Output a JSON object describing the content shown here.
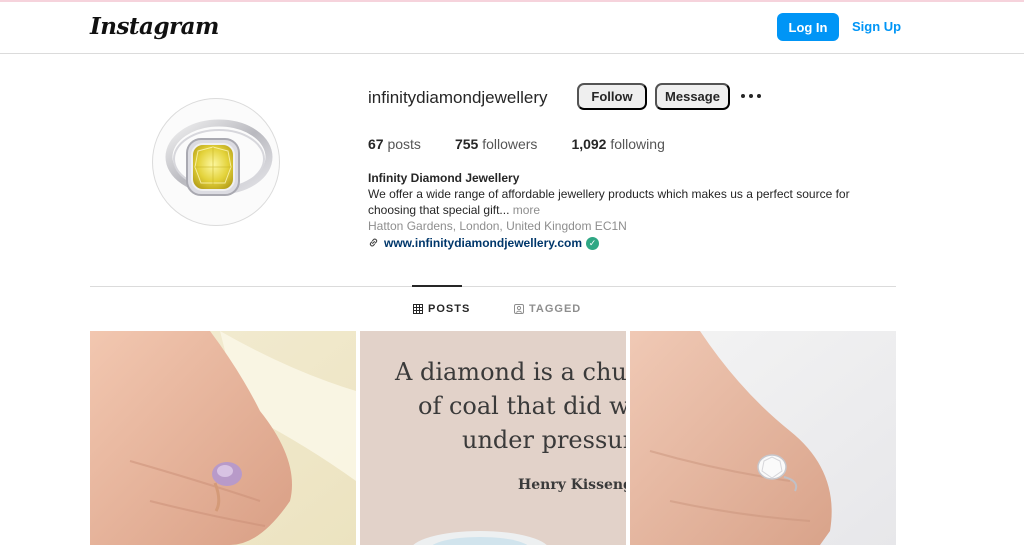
{
  "header": {
    "logo_text": "Instagram",
    "login_label": "Log In",
    "signup_label": "Sign Up"
  },
  "profile": {
    "username": "infinitydiamondjewellery",
    "follow_label": "Follow",
    "message_label": "Message",
    "more_icon": "more-horizontal-icon",
    "stats": {
      "posts_count": "67",
      "posts_label": "posts",
      "followers_count": "755",
      "followers_label": "followers",
      "following_count": "1,092",
      "following_label": "following"
    },
    "bio": {
      "name": "Infinity Diamond Jewellery",
      "text": "We offer a wide range of affordable jewellery products which makes us a perfect source for choosing that special gift...",
      "more_label": "more",
      "location": "Hatton Gardens, London, United Kingdom EC1N",
      "url": "www.infinitydiamondjewellery.com"
    }
  },
  "tabs": [
    {
      "label": "POSTS",
      "icon": "grid-icon",
      "active": true
    },
    {
      "label": "TAGGED",
      "icon": "tagged-icon",
      "active": false
    }
  ],
  "posts": {
    "quote_lines": [
      "A diamond is a chun",
      "of coal that did we",
      "under pressur"
    ],
    "quote_author": "Henry Kissenge"
  },
  "colors": {
    "accent": "#0095f6",
    "verified": "#2fa784",
    "link": "#00376b"
  }
}
